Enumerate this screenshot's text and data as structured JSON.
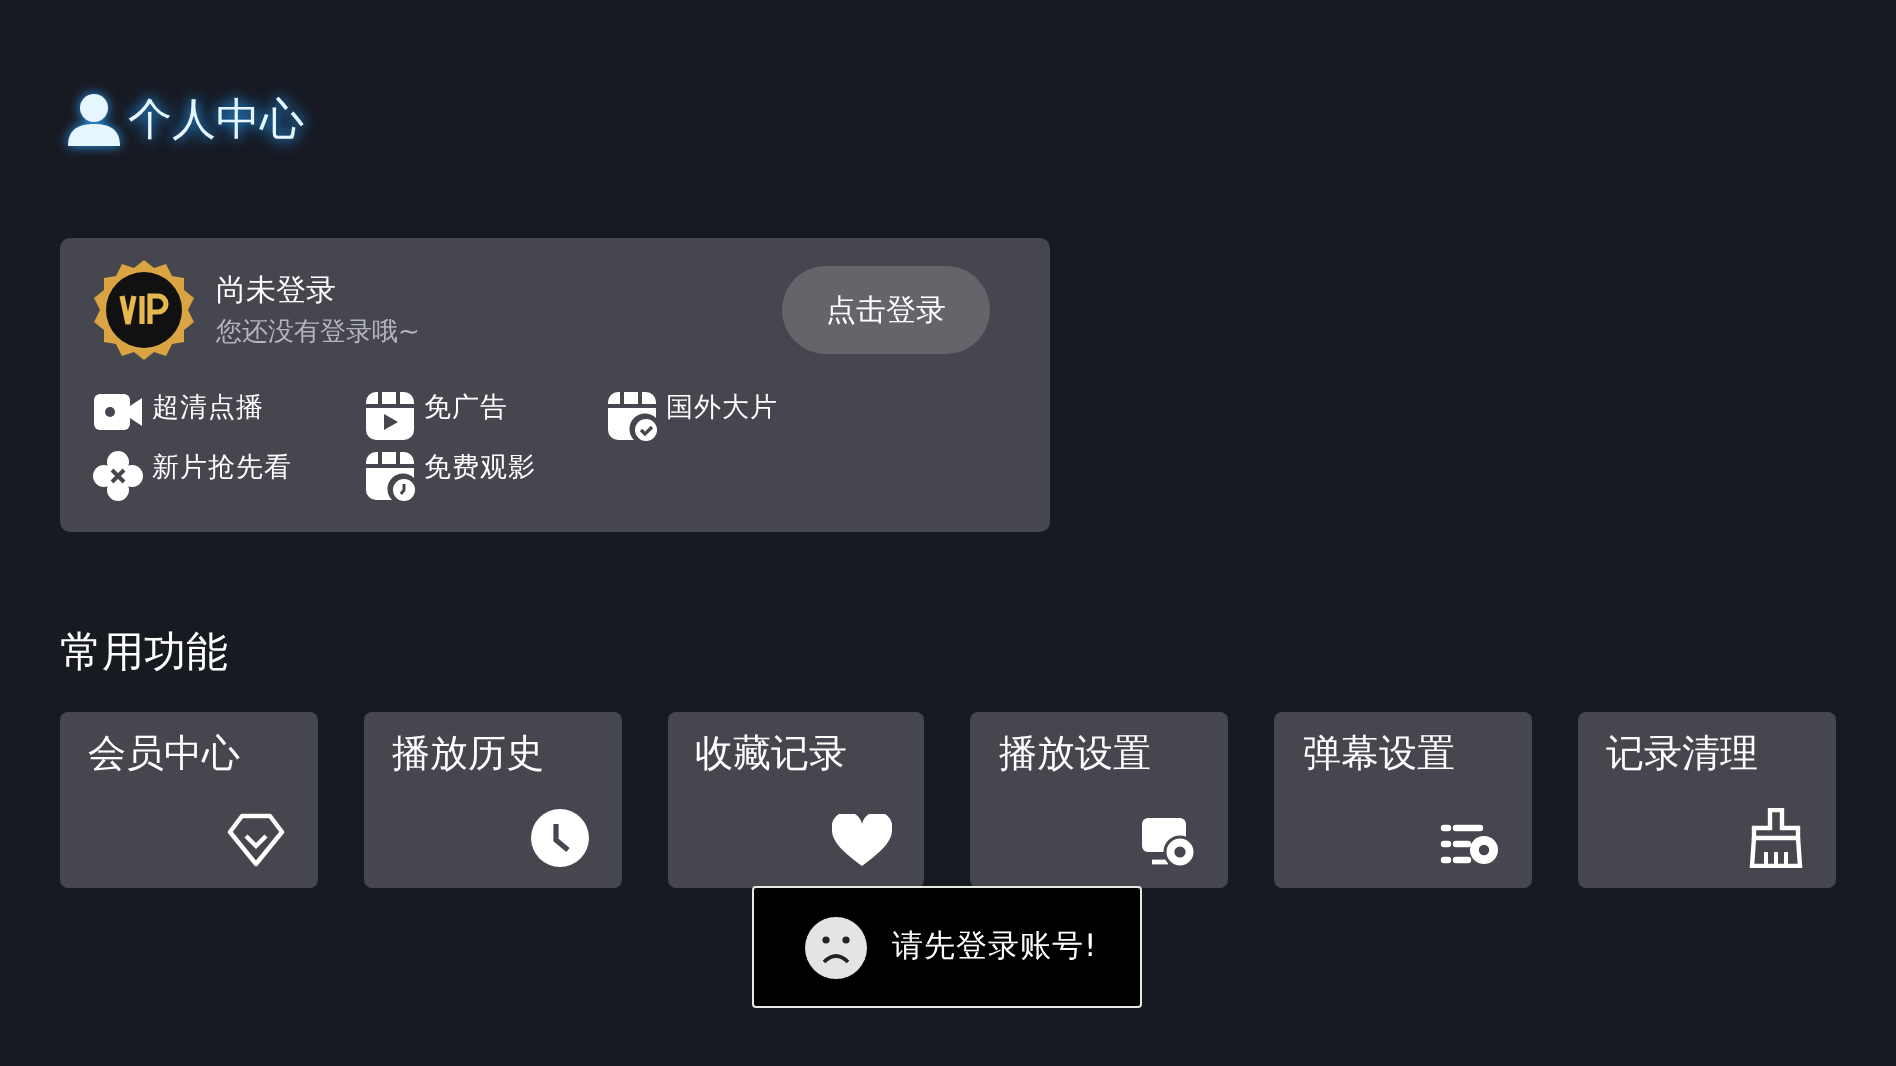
{
  "header": {
    "title": "个人中心"
  },
  "account": {
    "name": "尚未登录",
    "subtitle": "您还没有登录哦~",
    "login_button": "点击登录",
    "perks": [
      {
        "label": "超清点播"
      },
      {
        "label": "免广告"
      },
      {
        "label": "国外大片"
      },
      {
        "label": "新片抢先看"
      },
      {
        "label": "免费观影"
      }
    ]
  },
  "section": {
    "title": "常用功能"
  },
  "tiles": [
    {
      "label": "会员中心"
    },
    {
      "label": "播放历史"
    },
    {
      "label": "收藏记录"
    },
    {
      "label": "播放设置"
    },
    {
      "label": "弹幕设置"
    },
    {
      "label": "记录清理"
    }
  ],
  "toast": {
    "message": "请先登录账号!"
  }
}
